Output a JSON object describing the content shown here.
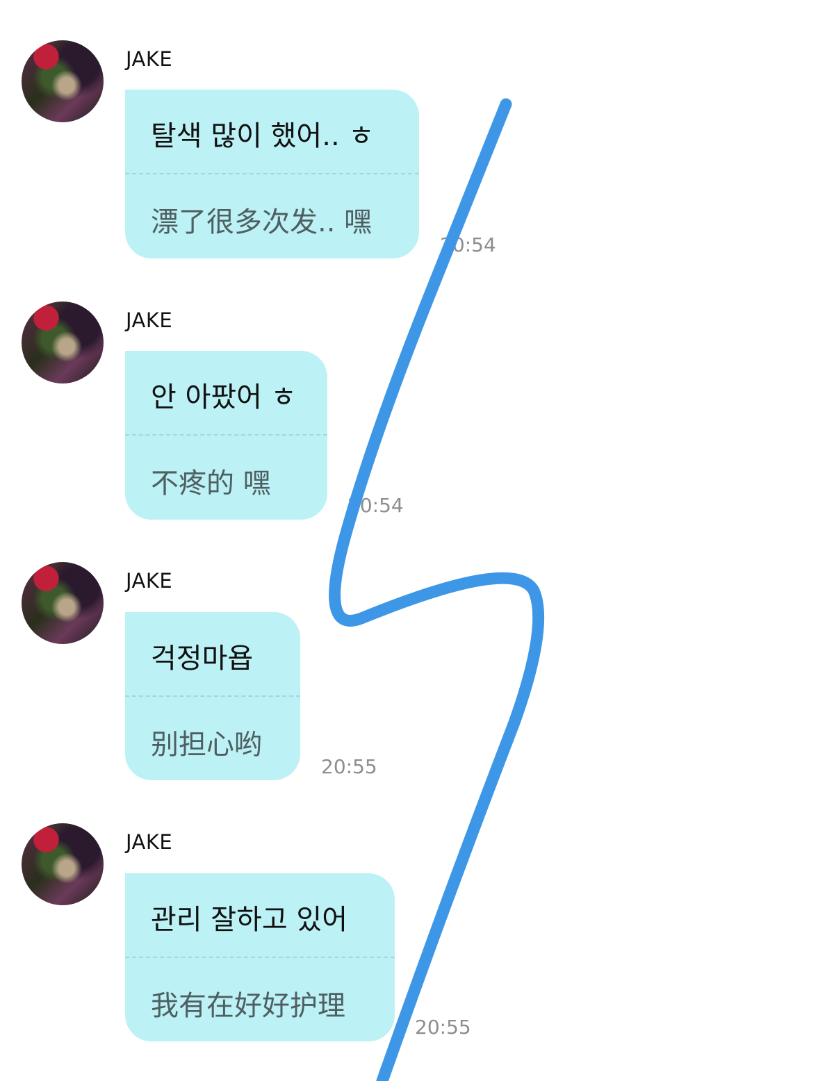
{
  "messages": [
    {
      "sender": "JAKE",
      "korean": "탈색 많이 했어.. ㅎ",
      "chinese": "漂了很多次发.. 嘿",
      "time": "20:54"
    },
    {
      "sender": "JAKE",
      "korean": "안 아팠어 ㅎ",
      "chinese": "不疼的 嘿",
      "time": "20:54"
    },
    {
      "sender": "JAKE",
      "korean": "걱정마욥",
      "chinese": "别担心哟",
      "time": "20:55"
    },
    {
      "sender": "JAKE",
      "korean": "관리 잘하고 있어",
      "chinese": "我有在好好护理",
      "time": "20:55"
    }
  ],
  "colors": {
    "bubble": "#bcf1f5",
    "scribble": "#3e97e6"
  }
}
